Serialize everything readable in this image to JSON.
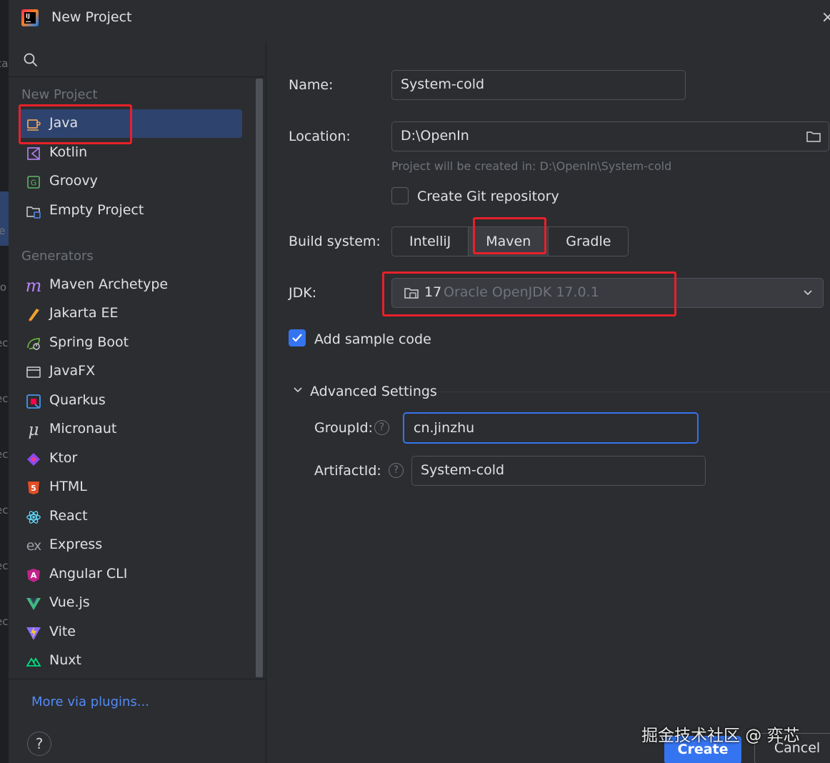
{
  "window": {
    "title": "New Project"
  },
  "background_fragments": [
    "ca",
    "je",
    "ro",
    "ec",
    "ec",
    "ec",
    "ec",
    "ec",
    "ec"
  ],
  "sidebar": {
    "section_new_project": "New Project",
    "new_project_items": [
      {
        "label": "Java",
        "icon": "java-cup-icon"
      },
      {
        "label": "Kotlin",
        "icon": "kotlin-icon"
      },
      {
        "label": "Groovy",
        "icon": "groovy-icon"
      },
      {
        "label": "Empty Project",
        "icon": "folder-icon"
      }
    ],
    "section_generators": "Generators",
    "generator_items": [
      {
        "label": "Maven Archetype",
        "icon": "maven-icon"
      },
      {
        "label": "Jakarta EE",
        "icon": "jakarta-icon"
      },
      {
        "label": "Spring Boot",
        "icon": "spring-icon"
      },
      {
        "label": "JavaFX",
        "icon": "window-icon"
      },
      {
        "label": "Quarkus",
        "icon": "quarkus-icon"
      },
      {
        "label": "Micronaut",
        "icon": "micronaut-icon"
      },
      {
        "label": "Ktor",
        "icon": "ktor-icon"
      },
      {
        "label": "HTML",
        "icon": "html5-icon"
      },
      {
        "label": "React",
        "icon": "react-icon"
      },
      {
        "label": "Express",
        "icon": "express-icon"
      },
      {
        "label": "Angular CLI",
        "icon": "angular-icon"
      },
      {
        "label": "Vue.js",
        "icon": "vue-icon"
      },
      {
        "label": "Vite",
        "icon": "vite-icon"
      },
      {
        "label": "Nuxt",
        "icon": "nuxt-icon"
      }
    ],
    "more_plugins": "More via plugins...",
    "help": "?"
  },
  "form": {
    "name_label": "Name:",
    "name_value": "System-cold",
    "location_label": "Location:",
    "location_value": "D:\\OpenIn",
    "location_hint": "Project will be created in: D:\\OpenIn\\System-cold",
    "git_label": "Create Git repository",
    "git_checked": false,
    "build_label": "Build system:",
    "build_options": [
      "IntelliJ",
      "Maven",
      "Gradle"
    ],
    "build_selected": "Maven",
    "jdk_label": "JDK:",
    "jdk_version": "17",
    "jdk_name": "Oracle OpenJDK 17.0.1",
    "sample_label": "Add sample code",
    "sample_checked": true,
    "advanced_label": "Advanced Settings",
    "groupid_label": "GroupId:",
    "groupid_value": "cn.jinzhu",
    "artifactid_label": "ArtifactId:",
    "artifactid_value": "System-cold"
  },
  "buttons": {
    "create": "Create",
    "cancel": "Cancel"
  },
  "watermark": "掘金技术社区 @ 弈芯",
  "colors": {
    "accent": "#3574f0",
    "selection": "#2e436e",
    "annotation": "#e8202a",
    "link": "#548af7"
  }
}
